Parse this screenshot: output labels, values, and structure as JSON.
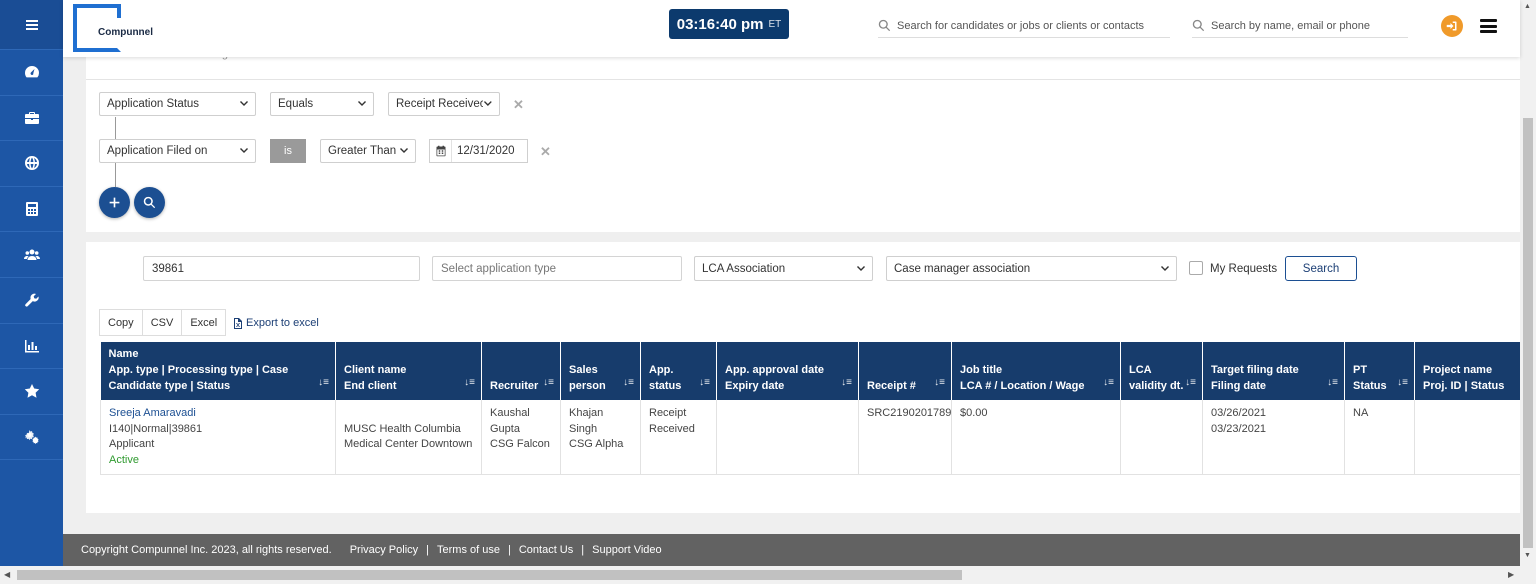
{
  "sidebar": {
    "items": [
      {
        "icon": "menu-icon"
      },
      {
        "icon": "dashboard-icon"
      },
      {
        "icon": "briefcase-icon"
      },
      {
        "icon": "globe-icon"
      },
      {
        "icon": "calculator-icon"
      },
      {
        "icon": "users-icon"
      },
      {
        "icon": "wrench-icon"
      },
      {
        "icon": "bar-chart-icon"
      },
      {
        "icon": "star-icon"
      },
      {
        "icon": "settings-icon"
      }
    ]
  },
  "header": {
    "logo_text": "Compunnel",
    "clock_time": "03:16:40 pm",
    "clock_tz": "ET",
    "search_main_placeholder": "Search for candidates or jobs or clients or contacts",
    "search_people_placeholder": "Search by name, email or phone"
  },
  "filter": {
    "faded_text": "Match   ALL   of the following",
    "row1": {
      "field": "Application Status",
      "operator": "Equals",
      "value": "Receipt Receivec"
    },
    "row2": {
      "field": "Application Filed on",
      "is_label": "is",
      "operator": "Greater Than",
      "date": "12/31/2020"
    }
  },
  "results": {
    "id_value": "39861",
    "app_type_placeholder": "Select application type",
    "lca_select": "LCA Association",
    "case_manager_select": "Case manager association",
    "my_requests_label": "My Requests",
    "search_label": "Search",
    "export_buttons": [
      "Copy",
      "CSV",
      "Excel"
    ],
    "export_excel_label": "Export to excel"
  },
  "table": {
    "headers": [
      [
        "Name",
        "App. type | Processing type | Case",
        "Candidate type | Status"
      ],
      [
        "Client name",
        "End client"
      ],
      [
        "Recruiter"
      ],
      [
        "Sales",
        "person"
      ],
      [
        "App.",
        "status"
      ],
      [
        "App. approval date",
        "Expiry date"
      ],
      [
        "Receipt #"
      ],
      [
        "Job title",
        "LCA # / Location / Wage"
      ],
      [
        "LCA",
        "validity dt."
      ],
      [
        "Target filing date",
        "Filing date"
      ],
      [
        "PT",
        "Status"
      ],
      [
        "Project name",
        "Proj. ID | Status"
      ]
    ],
    "row": {
      "name": "Sreeja Amaravadi",
      "app_type": "I140|Normal|39861",
      "candidate_type": "Applicant",
      "status": "Active",
      "client_name": "",
      "end_client": "MUSC Health Columbia Medical Center Downtown",
      "recruiter": "Kaushal Gupta",
      "recruiter_org": "CSG Falcon",
      "sales_person": "Khajan Singh",
      "sales_org": "CSG Alpha",
      "app_status": "Receipt Received",
      "approval": "",
      "receipt": "SRC2190201789",
      "job": "$0.00",
      "lca": "",
      "target_filing": "03/26/2021",
      "filing_date": "03/23/2021",
      "pt_status": "NA",
      "project": ""
    }
  },
  "footer": {
    "copyright": "Copyright Compunnel Inc. 2023, all rights reserved.",
    "links": [
      "Privacy Policy",
      "Terms of use",
      "Contact Us",
      "Support Video"
    ]
  },
  "colors": {
    "sidebar": "#1d56a5",
    "header_clock": "#0c3a6d",
    "table_header": "#173c6c",
    "accent_orange": "#f09a2a",
    "footer": "#626262"
  }
}
